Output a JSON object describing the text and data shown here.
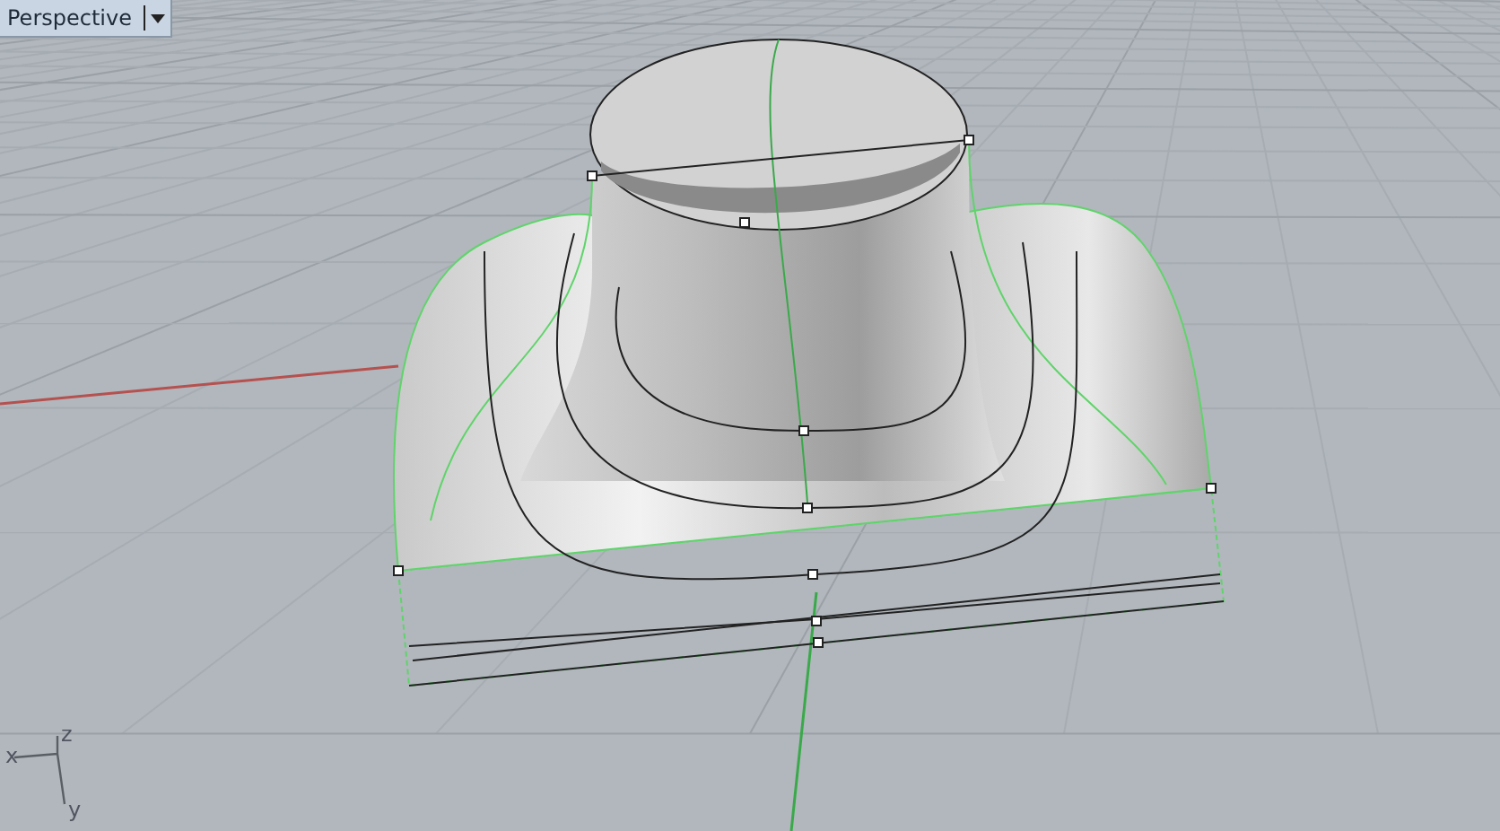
{
  "viewport": {
    "title": "Perspective"
  },
  "axes": [
    {
      "label": "x"
    },
    {
      "label": "z"
    },
    {
      "label": "y"
    }
  ]
}
